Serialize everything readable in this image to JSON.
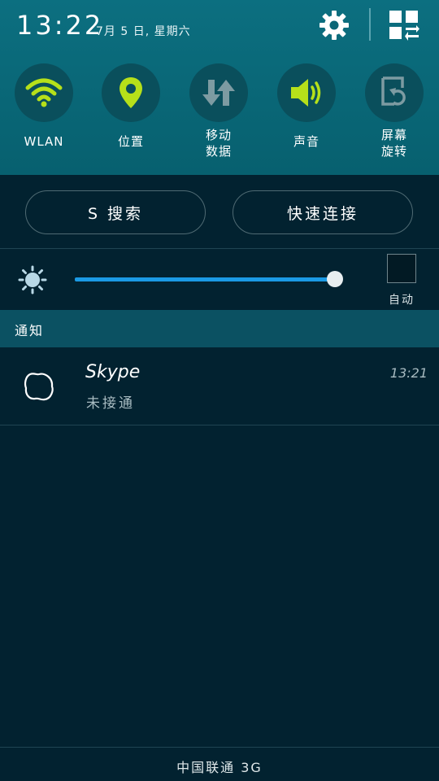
{
  "status": {
    "time": "13:22",
    "date": "7月 5 日, 星期六"
  },
  "icons": {
    "settings": "gear-icon",
    "quick_settings": "grid-toggle-icon"
  },
  "toggles": [
    {
      "label": "WLAN",
      "icon": "wifi-icon",
      "active": true
    },
    {
      "label": "位置",
      "icon": "location-pin-icon",
      "active": true
    },
    {
      "label": "移动\n数据",
      "icon": "mobile-data-icon",
      "active": false
    },
    {
      "label": "声音",
      "icon": "volume-icon",
      "active": true
    },
    {
      "label": "屏幕\n旋转",
      "icon": "rotate-icon",
      "active": false
    }
  ],
  "actions": {
    "s_search": "S 搜索",
    "quick_connect": "快速连接"
  },
  "brightness": {
    "level": 0.97,
    "auto_label": "自动",
    "auto_checked": false
  },
  "notifications": {
    "header": "通知",
    "items": [
      {
        "app": "Skype",
        "text": "未接通",
        "time": "13:21"
      }
    ]
  },
  "carrier": "中国联通 3G",
  "colors": {
    "active_green": "#b6e01a",
    "inactive_gray": "#6a8e96",
    "slider_blue": "#1b9ae4",
    "panel_teal": "#0c6f80"
  }
}
